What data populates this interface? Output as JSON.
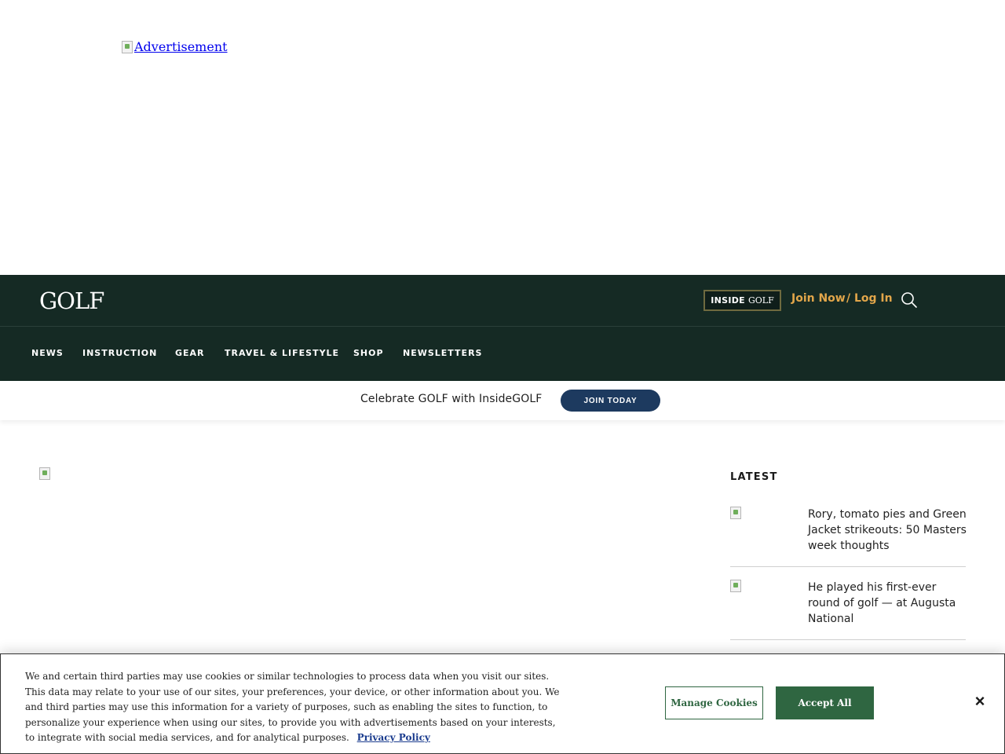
{
  "ad": {
    "label": "Advertisement"
  },
  "header": {
    "logo": "GOLF",
    "inside_badge": {
      "word1": "INSIDE",
      "word2": "GOLF"
    },
    "join_now": "Join Now",
    "login": "/ Log In",
    "search_icon": "search-icon"
  },
  "nav": {
    "items": [
      "NEWS",
      "INSTRUCTION",
      "GEAR",
      "TRAVEL & LIFESTYLE",
      "SHOP",
      "NEWSLETTERS"
    ]
  },
  "promo": {
    "text": "Celebrate GOLF with InsideGOLF",
    "button": "JOIN TODAY"
  },
  "latest": {
    "heading": "LATEST",
    "stories": [
      {
        "title": "Rory, tomato pies and Green Jacket strikeouts: 50 Masters week thoughts"
      },
      {
        "title": "He played his first-ever round of golf — at Augusta National"
      }
    ]
  },
  "cookie": {
    "text": "We and certain third parties may use cookies or similar technologies to process data when you visit our sites. This data may relate to your use of our sites, your preferences, your device, or other information about you. We and third parties may use this information for a variety of purposes, such as enabling the sites to function, to personalize your experience when using our sites, to provide you with advertisements based on your interests, to integrate with social media services, and for analytical purposes.",
    "policy_link": "Privacy Policy",
    "manage": "Manage Cookies",
    "accept": "Accept All",
    "close": "×"
  },
  "colors": {
    "header_bg": "#152a24",
    "accent_gold": "#e2a64a",
    "join_button": "#1d3a5f",
    "cookie_green": "#2f6641"
  }
}
